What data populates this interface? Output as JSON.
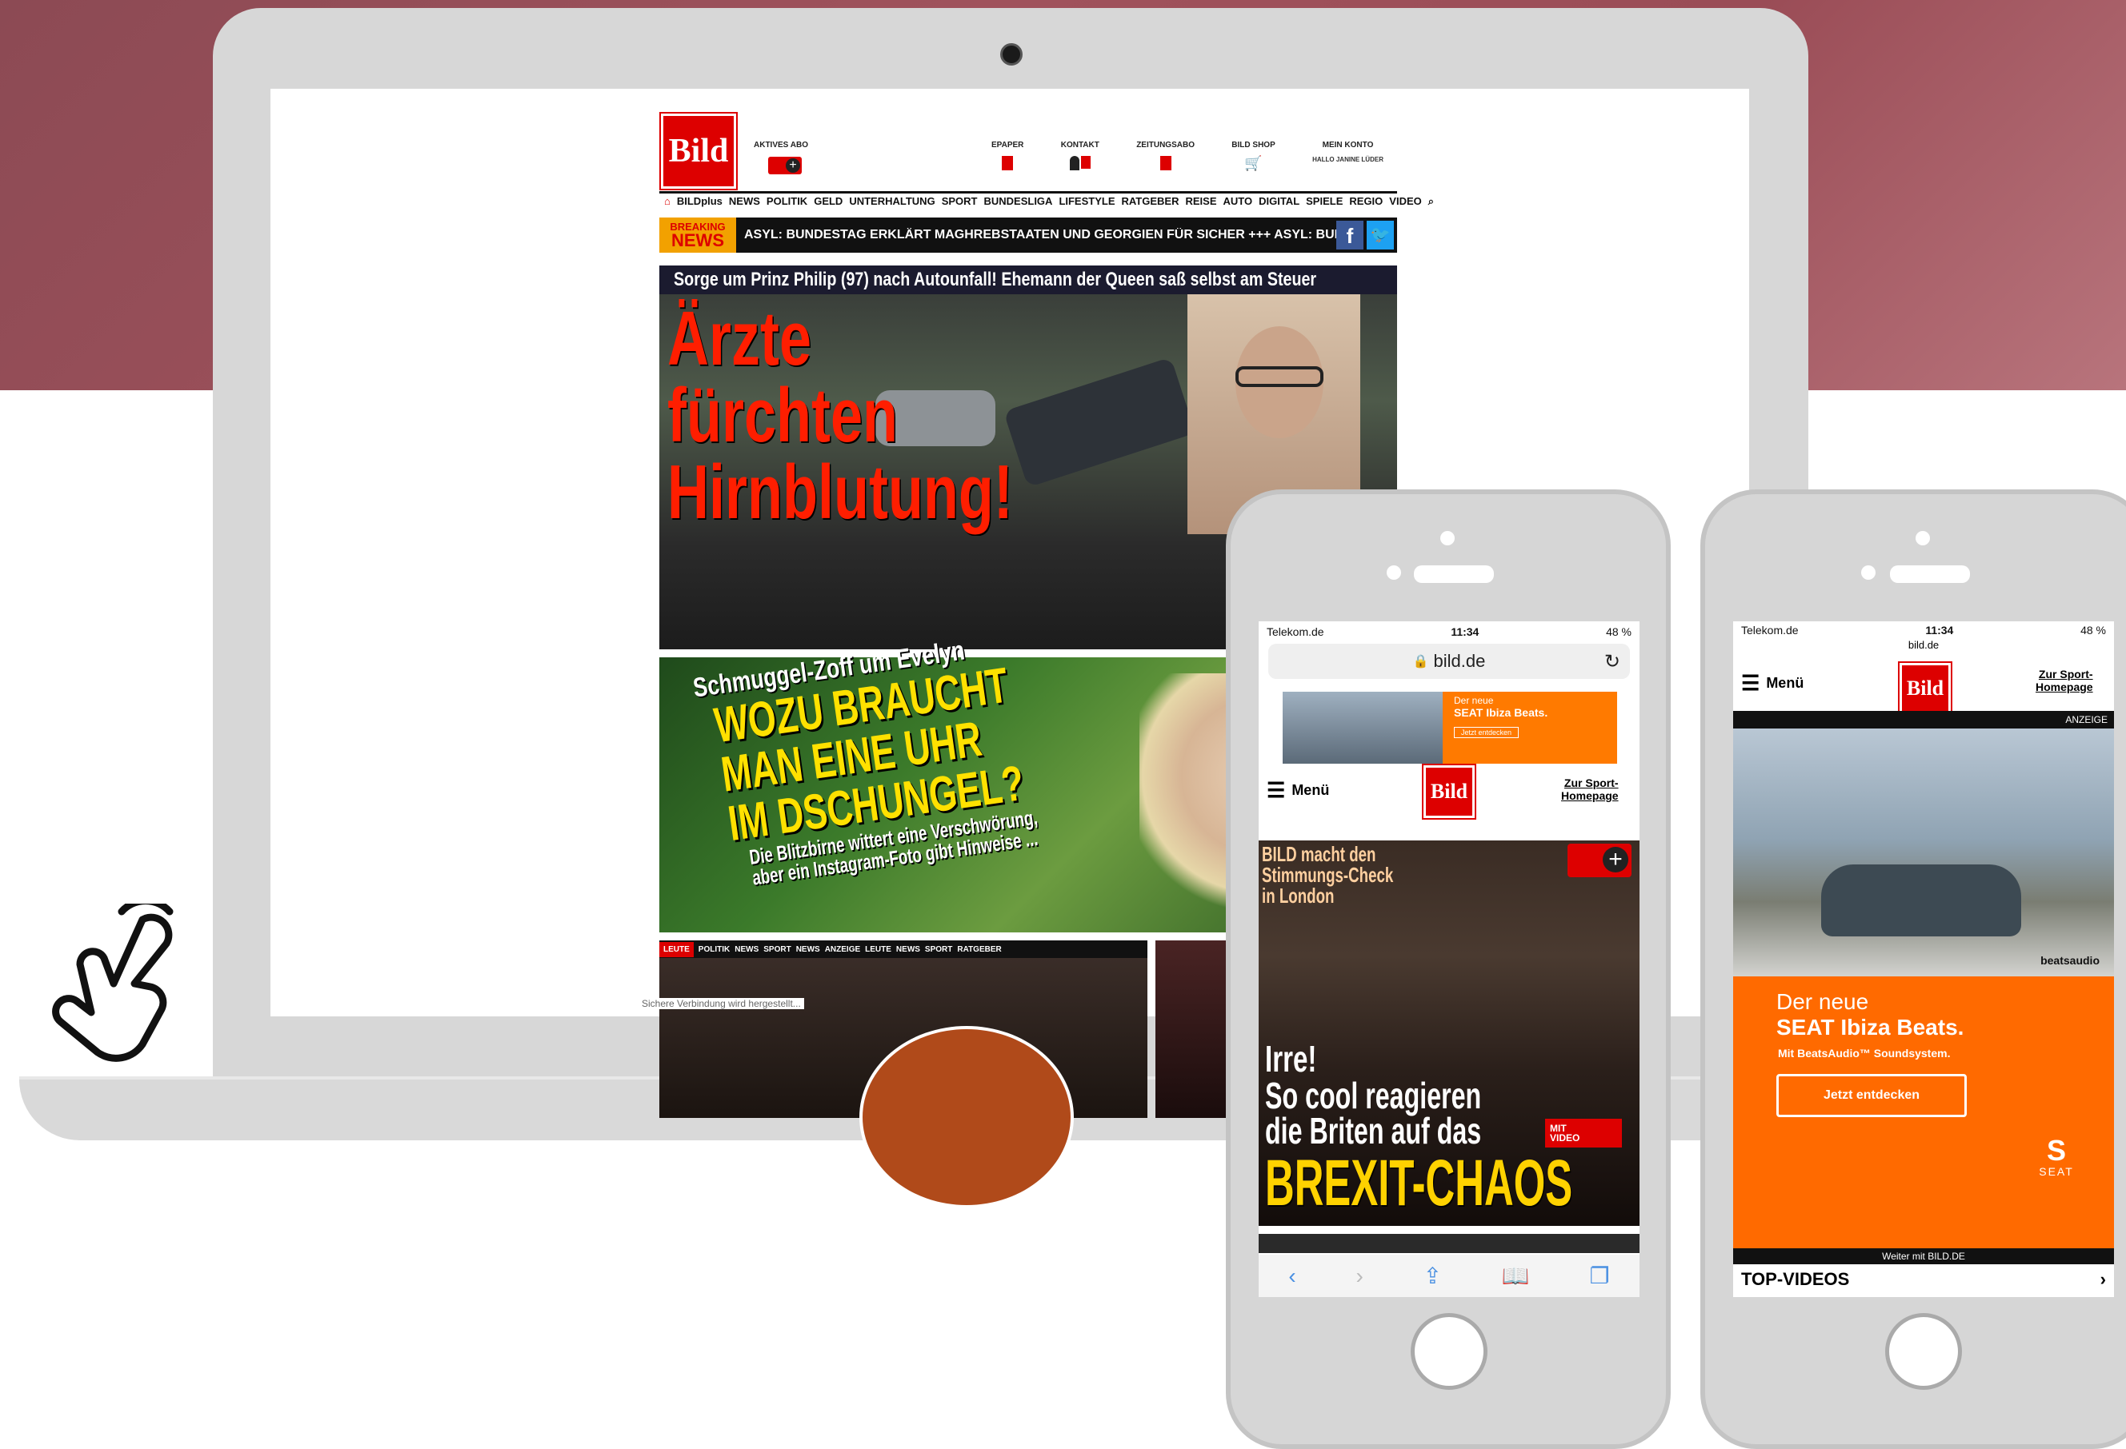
{
  "site": {
    "logo": "Bild",
    "aktives_abo": "AKTIVES ABO",
    "topnav": [
      "EPAPER",
      "KONTAKT",
      "ZEITUNGSABO",
      "BILD SHOP",
      "MEIN KONTO"
    ],
    "user_greeting": "HALLO JANINE LÜDER",
    "nav": [
      "BILDplus",
      "NEWS",
      "POLITIK",
      "GELD",
      "UNTERHALTUNG",
      "SPORT",
      "BUNDESLIGA",
      "LIFESTYLE",
      "RATGEBER",
      "REISE",
      "AUTO",
      "DIGITAL",
      "SPIELE",
      "REGIO",
      "VIDEO"
    ],
    "breaking_label_1": "BREAKING",
    "breaking_label_2": "NEWS",
    "breaking_ticker": "ASYL: BUNDESTAG ERKLÄRT MAGHREBSTAATEN UND GEORGIEN FÜR SICHER +++ ASYL: BUNDESTAG E",
    "hero_bar": "Sorge um Prinz Philip (97) nach Autounfall! Ehemann der Queen saß selbst am Steuer",
    "hero_headline": [
      "Ärzte",
      "fürchten",
      "Hirnblutung!"
    ],
    "teaser_kicker": "Schmuggel-Zoff um Evelyn",
    "teaser_headline": [
      "WOZU BRAUCHT",
      "MAN EINE UHR",
      "IM DSCHUNGEL?"
    ],
    "teaser_sub": [
      "Die Blitzbirne wittert eine Verschwörung,",
      "aber ein Instagram-Foto gibt Hinweise ..."
    ],
    "category_tabs": [
      "LEUTE",
      "POLITIK",
      "NEWS",
      "SPORT",
      "NEWS",
      "ANZEIGE",
      "LEUTE",
      "NEWS",
      "SPORT",
      "RATGEBER"
    ],
    "status_bar": "Sichere Verbindung wird hergestellt..."
  },
  "phone1": {
    "carrier": "Telekom.de",
    "time": "11:34",
    "battery": "48 %",
    "url": "bild.de",
    "ad_title": "Der neue",
    "ad_brand": "SEAT Ibiza Beats.",
    "ad_button": "Jetzt entdecken",
    "menu": "Menü",
    "logo": "Bild",
    "sport_link": [
      "Zur Sport-",
      "Homepage"
    ],
    "story_kicker": [
      "BILD macht den",
      "Stimmungs-Check",
      "in London"
    ],
    "story_line1": "Irre!",
    "story_line2": "So cool reagieren",
    "story_line3": "die Briten auf das",
    "story_line4": "BREXIT-CHAOS",
    "video_badge": [
      "MIT",
      "VIDEO"
    ]
  },
  "phone2": {
    "carrier": "Telekom.de",
    "time": "11:34",
    "battery": "48 %",
    "url": "bild.de",
    "menu": "Menü",
    "logo": "Bild",
    "sport_link": [
      "Zur Sport-",
      "Homepage"
    ],
    "anzeige": "ANZEIGE",
    "beats": "beatsaudio",
    "ad_title": "Der neue",
    "ad_brand": "SEAT Ibiza Beats.",
    "ad_sub": "Mit BeatsAudio™ Soundsystem.",
    "ad_button": "Jetzt entdecken",
    "seat": "SEAT",
    "continue": "Weiter mit BILD.DE",
    "section": "TOP-VIDEOS"
  },
  "colors": {
    "bild_red": "#dd0000",
    "seat_orange": "#ff6a00",
    "band": "#9a4c56",
    "device_grey": "#d7d7d7"
  }
}
